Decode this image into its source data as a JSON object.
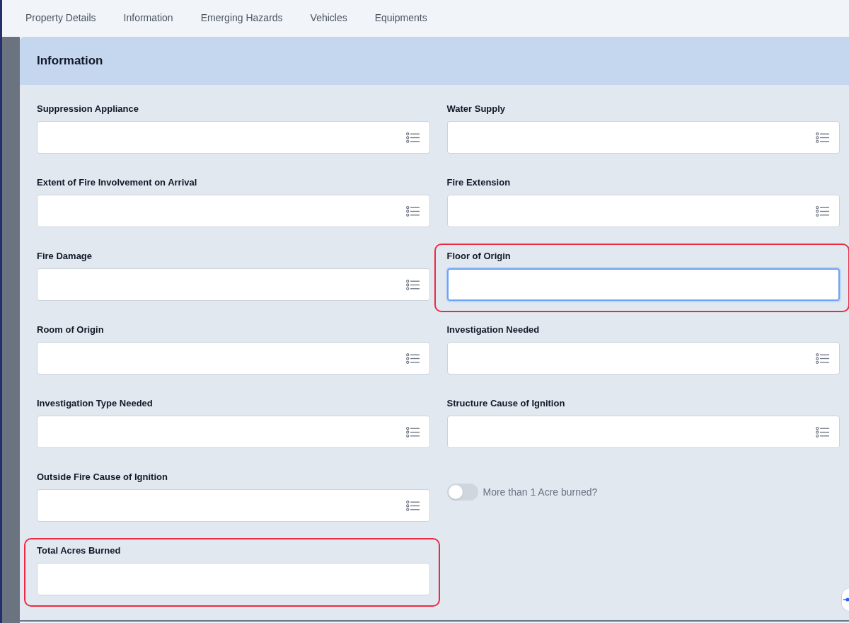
{
  "tabs": [
    {
      "label": "Property Details",
      "selected": false
    },
    {
      "label": "Information",
      "selected": false
    },
    {
      "label": "Emerging Hazards",
      "selected": false
    },
    {
      "label": "Vehicles",
      "selected": false
    },
    {
      "label": "Equipments",
      "selected": false
    }
  ],
  "section": {
    "title": "Information",
    "fields": [
      {
        "kind": "select",
        "label": "Suppression Appliance",
        "focused": false,
        "highlighted": false
      },
      {
        "kind": "select",
        "label": "Water Supply",
        "focused": false,
        "highlighted": false
      },
      {
        "kind": "select",
        "label": "Extent of Fire Involvement on Arrival",
        "focused": false,
        "highlighted": false
      },
      {
        "kind": "select",
        "label": "Fire Extension",
        "focused": false,
        "highlighted": false
      },
      {
        "kind": "select",
        "label": "Fire Damage",
        "focused": false,
        "highlighted": false
      },
      {
        "kind": "text",
        "label": "Floor of Origin",
        "focused": true,
        "highlighted": true
      },
      {
        "kind": "select",
        "label": "Room of Origin",
        "focused": false,
        "highlighted": false
      },
      {
        "kind": "select",
        "label": "Investigation Needed",
        "focused": false,
        "highlighted": false
      },
      {
        "kind": "select",
        "label": "Investigation Type Needed",
        "focused": false,
        "highlighted": false
      },
      {
        "kind": "select",
        "label": "Structure Cause of Ignition",
        "focused": false,
        "highlighted": false
      },
      {
        "kind": "select",
        "label": "Outside Fire Cause of Ignition",
        "focused": false,
        "highlighted": false
      },
      {
        "kind": "toggle",
        "label": "More than 1 Acre burned?",
        "on": false
      },
      {
        "kind": "text",
        "label": "Total Acres Burned",
        "focused": false,
        "highlighted": true
      }
    ]
  }
}
